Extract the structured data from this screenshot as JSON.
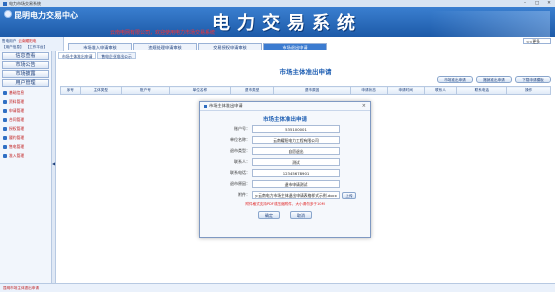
{
  "window": {
    "title": "电力市场交易系统",
    "controls": [
      "–",
      "□",
      "✕"
    ]
  },
  "banner": {
    "company": "昆明电力交易中心",
    "system_title": "电力交易系统",
    "ticker": "云南电网有限公司，欢迎使用电力市场交易系统"
  },
  "user": {
    "role_label": "售电用户",
    "role_value": "云南耀阳电",
    "links": [
      "【用户信息】",
      "【工作平台】",
      "【修改密码】",
      "【退出】"
    ]
  },
  "topnav": {
    "tabs": [
      "市场准入申请审核",
      "违规处理申请审核",
      "交易授权申请审核",
      "市场退出申请"
    ],
    "active_index": 3,
    "more_label": "<<更多"
  },
  "sidebar": {
    "groups": [
      "信息查看",
      "市场公告",
      "市场披露",
      "用户管理"
    ],
    "items": [
      "基础信息",
      "资料管理",
      "申请管理",
      "合同管理",
      "授权管理",
      "履约管理",
      "售电管理",
      "准入管理"
    ]
  },
  "subtabs": [
    "市场主体准出申请",
    "售电企业准出公示"
  ],
  "main": {
    "title": "市场主体准出申请",
    "actions": [
      "市场准出申请",
      "撤销准出申请",
      "下载申请模板"
    ],
    "columns": [
      "序号",
      "主体类型",
      "账户号",
      "单位名称",
      "退市类型",
      "退市原因",
      "申请状态",
      "申请时间",
      "联系人",
      "联系电话",
      "操作"
    ]
  },
  "dialog": {
    "header": "市场主体准出申请",
    "close": "×",
    "title": "市场主体准出申请",
    "fields": [
      {
        "label": "账户号：",
        "value": "535100001"
      },
      {
        "label": "单位名称：",
        "value": "云南耀阳电力工程有限公司"
      },
      {
        "label": "退市类型：",
        "value": "自愿退出"
      },
      {
        "label": "联系人：",
        "value": "测试"
      },
      {
        "label": "联系电话：",
        "value": "12345678901"
      },
      {
        "label": "退市原因：",
        "value": "退市申请测试"
      },
      {
        "label": "附件：",
        "value": "y:云南电力市场主体退出申请表格样式示例.docx"
      }
    ],
    "upload_label": "上传",
    "hint": "附件格式支持PDF或压缩附件，大小请勿多于10M",
    "confirm": "确定",
    "cancel": "取消"
  },
  "status": {
    "text": "昆明市场主体退出申请"
  }
}
